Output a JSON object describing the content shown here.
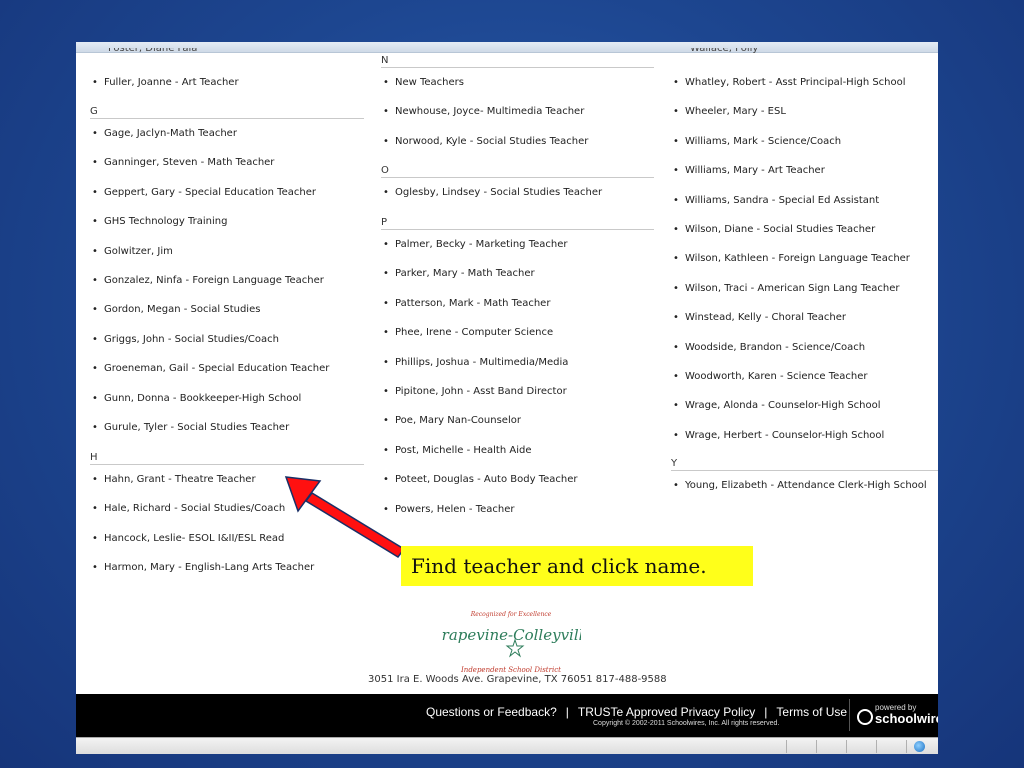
{
  "top_clipped": {
    "col1": "Foster, Diane Fala",
    "col3": "Wallace, Polly"
  },
  "col1": {
    "pre_entries": [
      {
        "label": "Fuller, Joanne - Art Teacher"
      }
    ],
    "sections": [
      {
        "letter": "G",
        "entries": [
          "Gage, Jaclyn-Math Teacher",
          "Ganninger, Steven - Math Teacher",
          "Geppert, Gary - Special Education Teacher",
          "GHS Technology Training",
          "Golwitzer, Jim",
          "Gonzalez, Ninfa - Foreign Language Teacher",
          "Gordon, Megan - Social Studies",
          "Griggs, John - Social Studies/Coach",
          "Groeneman, Gail - Special Education Teacher",
          "Gunn, Donna - Bookkeeper-High School",
          "Gurule, Tyler - Social Studies Teacher"
        ]
      },
      {
        "letter": "H",
        "entries": [
          "Hahn, Grant - Theatre Teacher",
          "Hale, Richard - Social Studies/Coach",
          "Hancock, Leslie- ESOL I&II/ESL Read",
          "Harmon, Mary - English-Lang Arts Teacher"
        ]
      }
    ]
  },
  "col2": {
    "sections": [
      {
        "letter": "N",
        "entries": [
          "New Teachers",
          "Newhouse, Joyce- Multimedia Teacher",
          "Norwood, Kyle - Social Studies Teacher"
        ]
      },
      {
        "letter": "O",
        "entries": [
          "Oglesby, Lindsey - Social Studies Teacher"
        ]
      },
      {
        "letter": "P",
        "entries": [
          "Palmer, Becky - Marketing Teacher",
          "Parker, Mary - Math Teacher",
          "Patterson, Mark - Math Teacher",
          "Phee, Irene - Computer Science",
          "Phillips, Joshua - Multimedia/Media",
          "Pipitone, John - Asst Band Director",
          "Poe, Mary Nan-Counselor",
          "Post, Michelle - Health Aide",
          "Poteet, Douglas - Auto Body Teacher",
          "Powers, Helen - Teacher"
        ]
      }
    ]
  },
  "col3": {
    "pre_entries": [
      "Whatley, Robert - Asst Principal-High School",
      "Wheeler, Mary - ESL",
      "Williams, Mark - Science/Coach",
      "Williams, Mary - Art Teacher",
      "Williams, Sandra - Special Ed Assistant",
      "Wilson, Diane - Social Studies Teacher",
      "Wilson, Kathleen - Foreign Language Teacher",
      "Wilson, Traci - American Sign Lang Teacher",
      "Winstead, Kelly - Choral Teacher",
      "Woodside, Brandon - Science/Coach",
      "Woodworth, Karen - Science Teacher",
      "Wrage, Alonda - Counselor-High School",
      "Wrage, Herbert - Counselor-High School"
    ],
    "sections": [
      {
        "letter": "Y",
        "entries": [
          "Young, Elizabeth - Attendance Clerk-High School"
        ]
      }
    ]
  },
  "callout": {
    "text": "Find teacher and click name.",
    "bg_color": "#ffff1a",
    "arrow_color": "#ff1010"
  },
  "logo": {
    "tagline": "Recognized for Excellence",
    "name": "Grapevine-Colleyville",
    "subtitle": "Independent School District",
    "color": "#2e7d5b",
    "accent": "#c0392b"
  },
  "address": "3051 Ira E. Woods Ave. Grapevine, TX 76051 817-488-9588",
  "footer": {
    "link1": "Questions or Feedback?",
    "separator": "|",
    "link2": "TRUSTe Approved Privacy Policy",
    "link3": "Terms of Use",
    "copyright": "Copyright © 2002-2011 Schoolwires, Inc. All rights reserved.",
    "powered_by": "powered by",
    "brand": "schoolwires"
  }
}
